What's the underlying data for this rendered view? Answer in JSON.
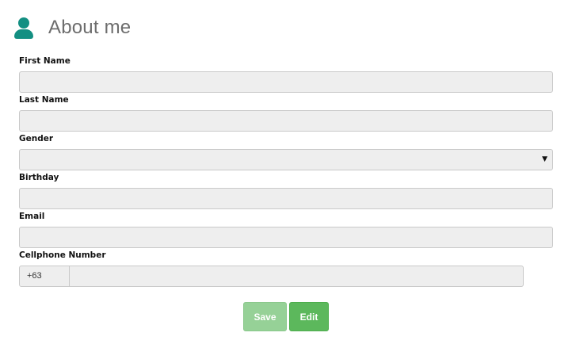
{
  "header": {
    "title": "About me",
    "icon": "user-icon",
    "icon_color": "#138f82"
  },
  "form": {
    "fields": [
      {
        "label": "First Name",
        "value": ""
      },
      {
        "label": "Last Name",
        "value": ""
      },
      {
        "label": "Gender",
        "value": ""
      },
      {
        "label": "Birthday",
        "value": ""
      },
      {
        "label": "Email",
        "value": ""
      },
      {
        "label": "Cellphone Number",
        "value": ""
      }
    ],
    "phone_prefix": "+63"
  },
  "buttons": {
    "save_label": "Save",
    "edit_label": "Edit",
    "save_color": "#96d197",
    "edit_color": "#5cb85c"
  }
}
